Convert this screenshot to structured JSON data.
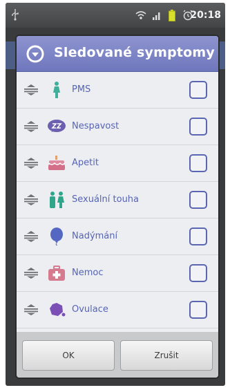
{
  "status_bar": {
    "time": "20:18",
    "icons": [
      "usb-icon",
      "wifi-icon",
      "signal-icon",
      "battery-icon",
      "alarm-icon"
    ]
  },
  "dialog": {
    "title": "Sledované symptomy",
    "title_icon": "chevron-down-circle-icon",
    "header_color": "#7a82c5",
    "label_color": "#5663b7",
    "items": [
      {
        "label": "PMS",
        "icon": "woman-icon",
        "icon_color": "#3fae9b",
        "checked": false
      },
      {
        "label": "Nespavost",
        "icon": "zzz-icon",
        "icon_color": "#6c5fb0",
        "checked": false
      },
      {
        "label": "Apetit",
        "icon": "cake-icon",
        "icon_color": "#e08aa0",
        "checked": false
      },
      {
        "label": "Sexuální touha",
        "icon": "couple-icon",
        "icon_color": "#2fa58a",
        "checked": false
      },
      {
        "label": "Nadýmání",
        "icon": "balloon-icon",
        "icon_color": "#5468c2",
        "checked": false
      },
      {
        "label": "Nemoc",
        "icon": "medkit-icon",
        "icon_color": "#d67a8f",
        "checked": false
      },
      {
        "label": "Ovulace",
        "icon": "ovum-icon",
        "icon_color": "#7b4fb5",
        "checked": false
      }
    ],
    "buttons": {
      "ok": "OK",
      "cancel": "Zrušit"
    }
  }
}
